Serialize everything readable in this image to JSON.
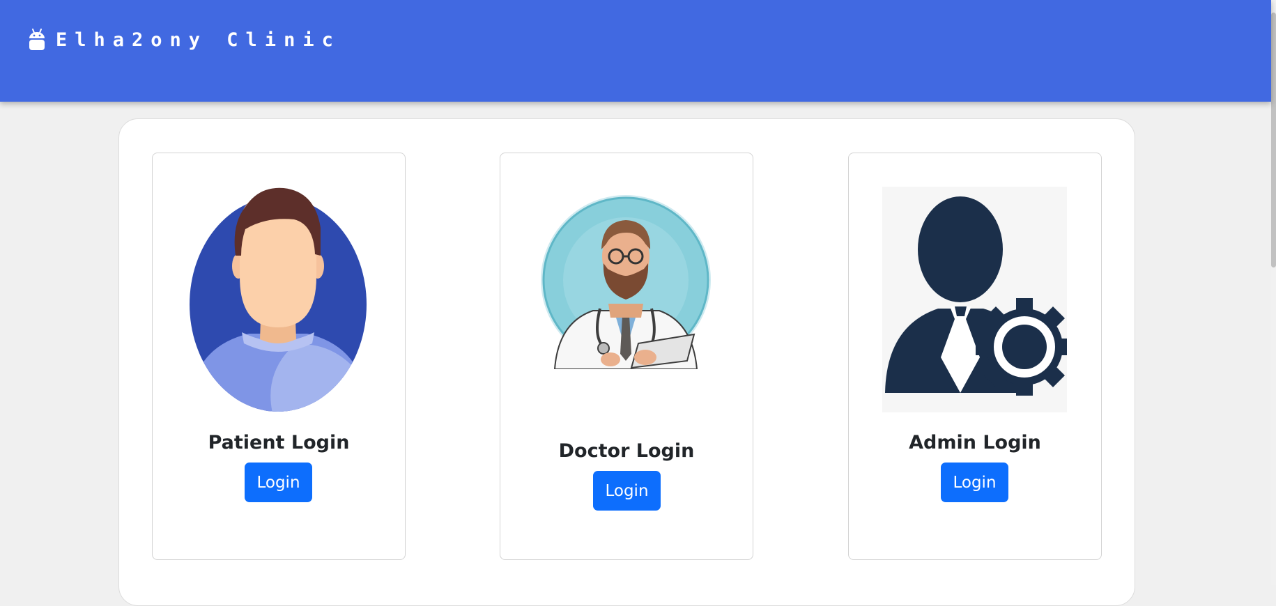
{
  "header": {
    "brand_icon": "android-icon",
    "title": "Elha2ony Clinic",
    "color": "#4169e1"
  },
  "cards": [
    {
      "image": "patient-avatar",
      "title": "Patient Login",
      "button_label": "Login"
    },
    {
      "image": "doctor-illustration",
      "title": "Doctor Login",
      "button_label": "Login"
    },
    {
      "image": "admin-gear-avatar",
      "title": "Admin Login",
      "button_label": "Login"
    }
  ],
  "colors": {
    "button": "#0d6efd",
    "admin_icon": "#1b2f4a",
    "patient_bg": "#2e4aaf"
  }
}
